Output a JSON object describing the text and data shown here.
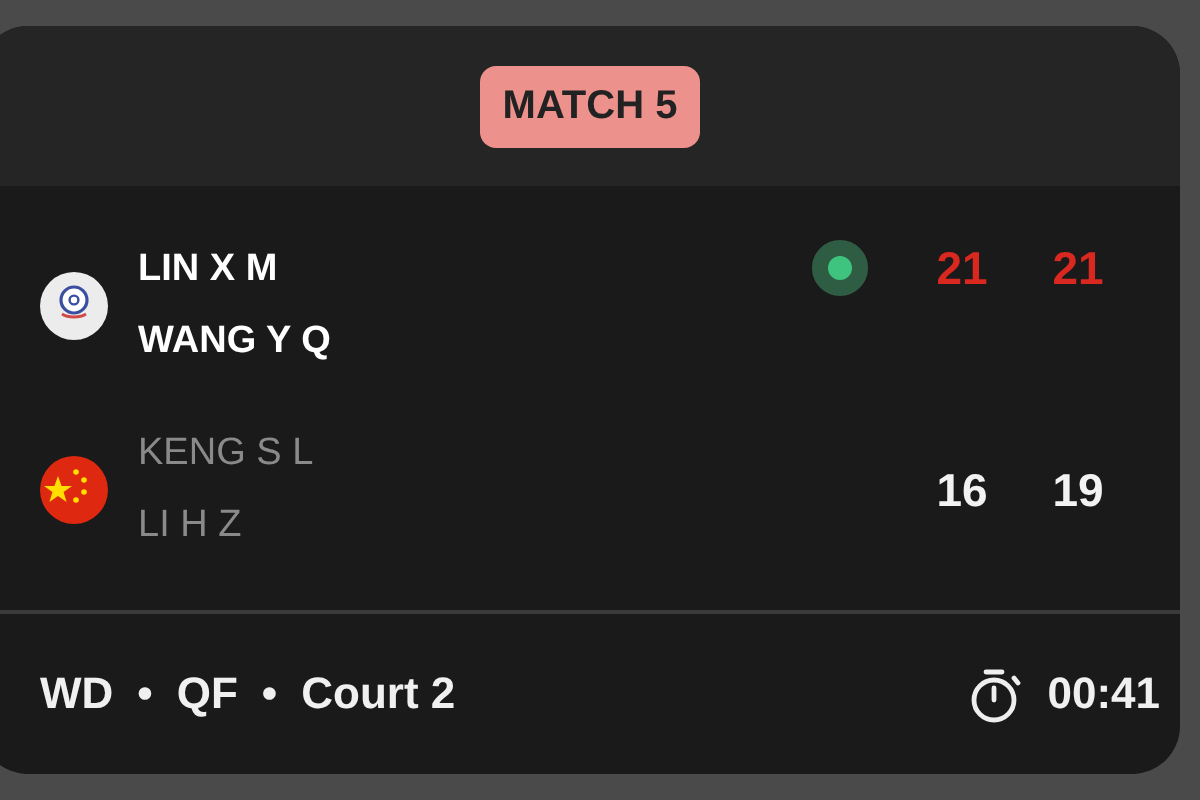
{
  "badge": "MATCH 5",
  "teams": [
    {
      "flag": {
        "kind": "tpe"
      },
      "players": [
        "LIN X M",
        "WANG Y Q"
      ],
      "winner": true,
      "serving": true,
      "scores": [
        {
          "value": "21",
          "won": true
        },
        {
          "value": "21",
          "won": true
        }
      ]
    },
    {
      "flag": {
        "kind": "chn"
      },
      "players": [
        "KENG S L",
        "LI H Z"
      ],
      "winner": false,
      "serving": false,
      "scores": [
        {
          "value": "16",
          "won": false
        },
        {
          "value": "19",
          "won": false
        }
      ]
    }
  ],
  "footer": {
    "details": [
      "WD",
      "•",
      "QF",
      "•",
      "Court 2"
    ],
    "duration": "00:41"
  }
}
